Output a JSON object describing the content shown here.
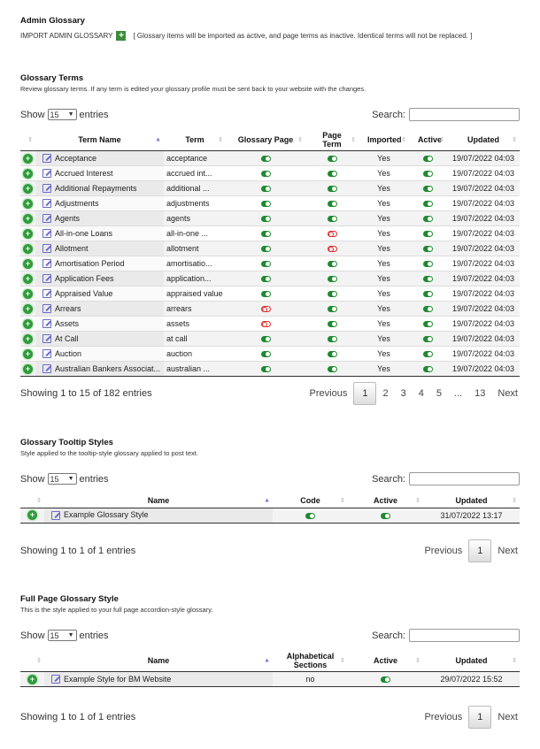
{
  "admin": {
    "title": "Admin Glossary",
    "import_label": "IMPORT ADMIN GLOSSARY",
    "import_icon": "plus-icon",
    "note": "[ Glossary items will be imported as active, and page terms as inactive. Identical terms will not be replaced. ]"
  },
  "common": {
    "show": "Show",
    "entries": "entries",
    "page_size": "15",
    "search": "Search:",
    "previous": "Previous",
    "next": "Next"
  },
  "colors": {
    "toggle_on": "#1e8a2e",
    "toggle_off": "#e02b2b",
    "add": "#2e9b3a",
    "edit": "#6b6bc8"
  },
  "terms": {
    "title": "Glossary Terms",
    "description": "Review glossary terms. If any term is edited your glossary profile must be sent back to your website with the changes.",
    "columns": [
      "",
      "Term Name",
      "Term",
      "Glossary Page",
      "Page Term",
      "Imported",
      "Active",
      "Updated"
    ],
    "rows": [
      {
        "name": "Acceptance",
        "term": "acceptance",
        "glossary_page": true,
        "page_term": true,
        "imported": "Yes",
        "active": true,
        "updated": "19/07/2022 04:03"
      },
      {
        "name": "Accrued Interest",
        "term": "accrued int...",
        "glossary_page": true,
        "page_term": true,
        "imported": "Yes",
        "active": true,
        "updated": "19/07/2022 04:03"
      },
      {
        "name": "Additional Repayments",
        "term": "additional ...",
        "glossary_page": true,
        "page_term": true,
        "imported": "Yes",
        "active": true,
        "updated": "19/07/2022 04:03"
      },
      {
        "name": "Adjustments",
        "term": "adjustments",
        "glossary_page": true,
        "page_term": true,
        "imported": "Yes",
        "active": true,
        "updated": "19/07/2022 04:03"
      },
      {
        "name": "Agents",
        "term": "agents",
        "glossary_page": true,
        "page_term": true,
        "imported": "Yes",
        "active": true,
        "updated": "19/07/2022 04:03"
      },
      {
        "name": "All-in-one Loans",
        "term": "all-in-one ...",
        "glossary_page": true,
        "page_term": false,
        "imported": "Yes",
        "active": true,
        "updated": "19/07/2022 04:03"
      },
      {
        "name": "Allotment",
        "term": "allotment",
        "glossary_page": true,
        "page_term": false,
        "imported": "Yes",
        "active": true,
        "updated": "19/07/2022 04:03"
      },
      {
        "name": "Amortisation Period",
        "term": "amortisatio...",
        "glossary_page": true,
        "page_term": true,
        "imported": "Yes",
        "active": true,
        "updated": "19/07/2022 04:03"
      },
      {
        "name": "Application Fees",
        "term": "application...",
        "glossary_page": true,
        "page_term": true,
        "imported": "Yes",
        "active": true,
        "updated": "19/07/2022 04:03"
      },
      {
        "name": "Appraised Value",
        "term": "appraised value",
        "glossary_page": true,
        "page_term": true,
        "imported": "Yes",
        "active": true,
        "updated": "19/07/2022 04:03"
      },
      {
        "name": "Arrears",
        "term": "arrears",
        "glossary_page": false,
        "page_term": true,
        "imported": "Yes",
        "active": true,
        "updated": "19/07/2022 04:03"
      },
      {
        "name": "Assets",
        "term": "assets",
        "glossary_page": false,
        "page_term": true,
        "imported": "Yes",
        "active": true,
        "updated": "19/07/2022 04:03"
      },
      {
        "name": "At Call",
        "term": "at call",
        "glossary_page": true,
        "page_term": true,
        "imported": "Yes",
        "active": true,
        "updated": "19/07/2022 04:03"
      },
      {
        "name": "Auction",
        "term": "auction",
        "glossary_page": true,
        "page_term": true,
        "imported": "Yes",
        "active": true,
        "updated": "19/07/2022 04:03"
      },
      {
        "name": "Australian Bankers Associat...",
        "term": "australian ...",
        "glossary_page": true,
        "page_term": true,
        "imported": "Yes",
        "active": true,
        "updated": "19/07/2022 04:03"
      }
    ],
    "info": "Showing 1 to 15 of 182 entries",
    "pages": [
      "1",
      "2",
      "3",
      "4",
      "5",
      "...",
      "13"
    ],
    "current_page": "1"
  },
  "tooltip": {
    "title": "Glossary Tooltip Styles",
    "description": "Style applied to the tooltip-style glossary applied to post text.",
    "columns": [
      "",
      "Name",
      "Code",
      "Active",
      "Updated"
    ],
    "rows": [
      {
        "name": "Example Glossary Style",
        "code": true,
        "active": true,
        "updated": "31/07/2022 13:17"
      }
    ],
    "info": "Showing 1 to 1 of 1 entries",
    "pages": [
      "1"
    ]
  },
  "fullpage": {
    "title": "Full Page Glossary Style",
    "description": "This is the style applied to your full page accordion-style glossary.",
    "columns": [
      "",
      "Name",
      "Alphabetical Sections",
      "Active",
      "Updated"
    ],
    "rows": [
      {
        "name": "Example Style for BM Website",
        "alphabetical": "no",
        "active": true,
        "updated": "29/07/2022 15:52"
      }
    ],
    "info": "Showing 1 to 1 of 1 entries",
    "pages": [
      "1"
    ]
  }
}
